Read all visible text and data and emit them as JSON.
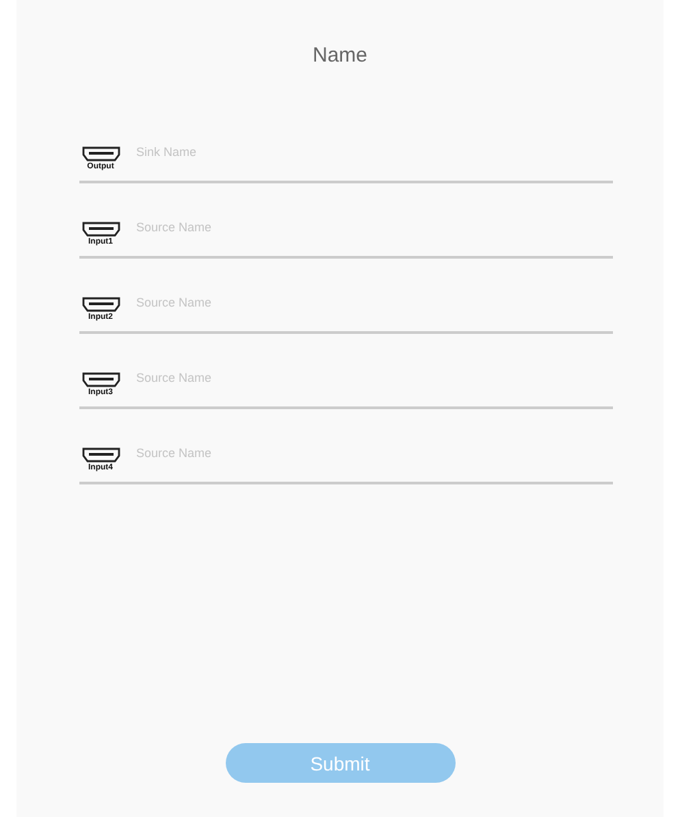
{
  "title": "Name",
  "ports": [
    {
      "label": "Output",
      "placeholder": "Sink Name"
    },
    {
      "label": "Input1",
      "placeholder": "Source Name"
    },
    {
      "label": "Input2",
      "placeholder": "Source Name"
    },
    {
      "label": "Input3",
      "placeholder": "Source Name"
    },
    {
      "label": "Input4",
      "placeholder": "Source Name"
    }
  ],
  "submit": {
    "label": "Submit"
  }
}
